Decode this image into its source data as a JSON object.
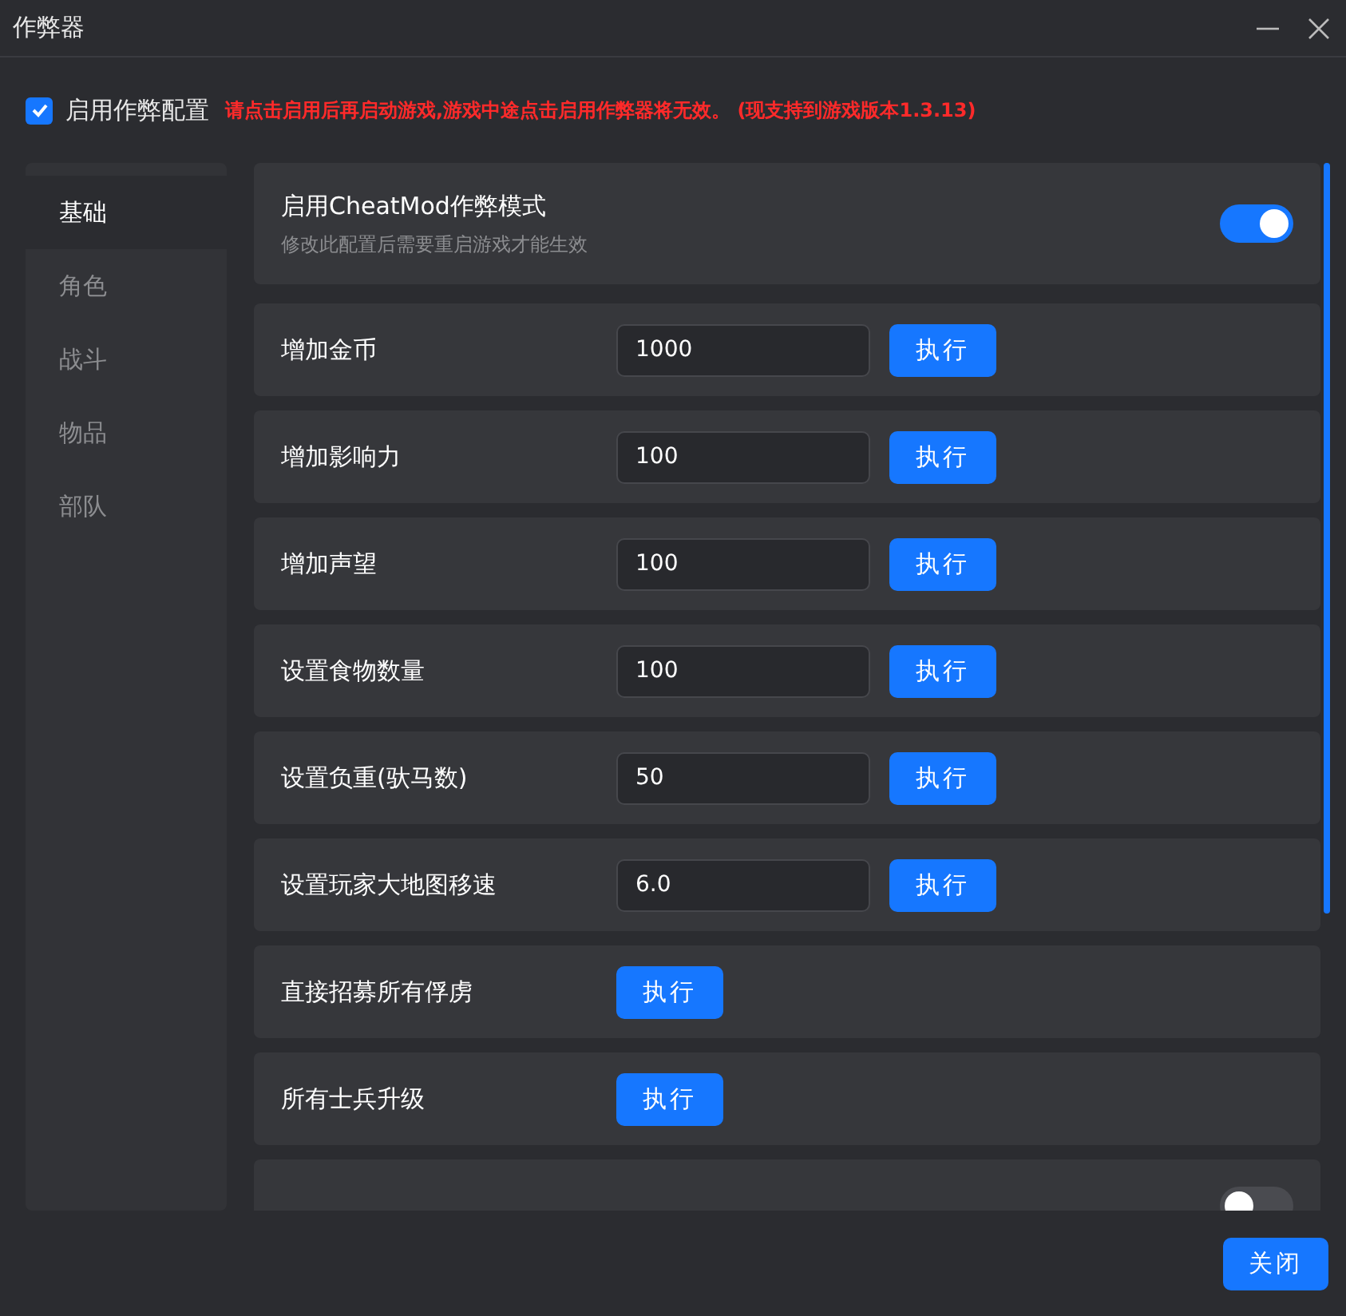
{
  "window": {
    "title": "作弊器"
  },
  "enable": {
    "label": "启用作弊配置",
    "checked": true,
    "notice": "请点击启用后再启动游戏,游戏中途点击启用作弊器将无效。 (现支持到游戏版本1.3.13)"
  },
  "sidebar": {
    "items": [
      {
        "label": "基础",
        "selected": true
      },
      {
        "label": "角色",
        "selected": false
      },
      {
        "label": "战斗",
        "selected": false
      },
      {
        "label": "物品",
        "selected": false
      },
      {
        "label": "部队",
        "selected": false
      }
    ]
  },
  "settings": [
    {
      "kind": "toggle",
      "label": "启用CheatMod作弊模式",
      "description": "修改此配置后需要重启游戏才能生效",
      "on": true
    },
    {
      "kind": "input",
      "label": "增加金币",
      "value": "1000",
      "button": "执行"
    },
    {
      "kind": "input",
      "label": "增加影响力",
      "value": "100",
      "button": "执行"
    },
    {
      "kind": "input",
      "label": "增加声望",
      "value": "100",
      "button": "执行"
    },
    {
      "kind": "input",
      "label": "设置食物数量",
      "value": "100",
      "button": "执行"
    },
    {
      "kind": "input",
      "label": "设置负重(驮马数)",
      "value": "50",
      "button": "执行"
    },
    {
      "kind": "input",
      "label": "设置玩家大地图移速",
      "value": "6.0",
      "button": "执行"
    },
    {
      "kind": "action",
      "label": "直接招募所有俘虏",
      "button": "执行"
    },
    {
      "kind": "action",
      "label": "所有士兵升级",
      "button": "执行"
    },
    {
      "kind": "toggle",
      "on": false
    }
  ],
  "close_button": "关闭"
}
